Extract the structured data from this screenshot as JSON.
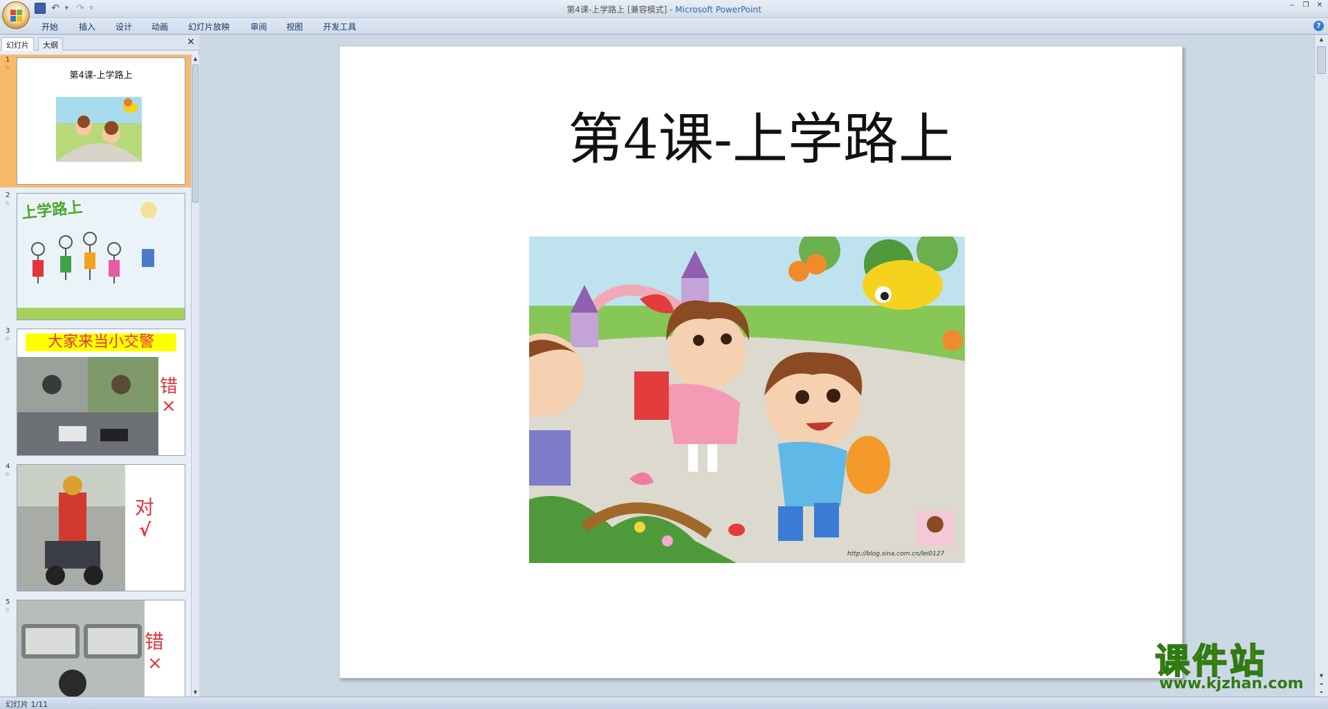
{
  "window": {
    "title_main": "第4课-上学路上 [兼容模式] - ",
    "title_app": "Microsoft PowerPoint"
  },
  "ribbon": {
    "tabs": [
      "开始",
      "插入",
      "设计",
      "动画",
      "幻灯片放映",
      "审阅",
      "视图",
      "开发工具"
    ]
  },
  "left_pane": {
    "tabs": [
      "幻灯片",
      "大纲"
    ],
    "thumbnails": [
      {
        "number": "1",
        "title": "第4课-上学路上"
      },
      {
        "number": "2",
        "caption": "上学路上"
      },
      {
        "number": "3",
        "banner": "大家来当小交警",
        "verdict": "错",
        "mark": "×"
      },
      {
        "number": "4",
        "verdict": "对",
        "mark": "√"
      },
      {
        "number": "5",
        "verdict": "错",
        "mark": "×"
      }
    ]
  },
  "slide": {
    "title": "第4课-上学路上",
    "image_credit": "http://blog.sina.com.cn/lei0127"
  },
  "status": {
    "slide_position": "幻灯片 1/11"
  },
  "watermark": {
    "brand": "课件站",
    "url": "www.kjzhan.com"
  },
  "colors": {
    "accent_blue": "#3566a8",
    "selected_thumb": "#f6ba6a",
    "verdict_red": "#e0353a",
    "banner_yellow": "#ffff00",
    "watermark_yellow": "#f6e200",
    "watermark_green": "#2f7a12"
  }
}
